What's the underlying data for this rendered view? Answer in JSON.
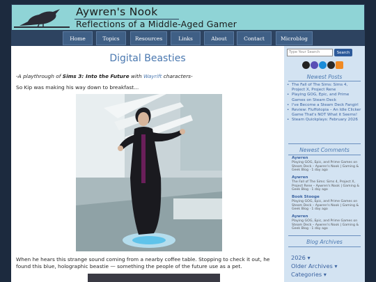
{
  "header": {
    "site_title": "Aywren's Nook",
    "site_subtitle": "Reflections of a Middle-Aged Gamer"
  },
  "nav": [
    "Home",
    "Topics",
    "Resources",
    "Links",
    "About",
    "Contact",
    "Microblog"
  ],
  "post": {
    "title": "Digital Beasties",
    "intro_prefix": "-A playthrough of ",
    "intro_game": "Sims 3: Into the Future",
    "intro_with": " with ",
    "intro_link": "Wayrift",
    "intro_suffix": " characters-",
    "para1": "So Kip was making his way down to breakfast...",
    "para2": "When he hears this strange sound coming from a nearby coffee table. Stopping to check it out, he found this blue, holographic beastie — something the people of the future use as a pet."
  },
  "sidebar": {
    "search_placeholder": "Type Your Search",
    "search_button": "Search",
    "newest_posts_heading": "Newest Posts",
    "newest_posts": [
      "The Fall of The Sims: Sims 4, Project X, Project Rene",
      "Playing GOG, Epic, and Prime Games on Steam Deck",
      "I've Become a Steam Deck Fangirl",
      "Review: Fluffotopia – An Idle Clicker Game That's NOT What it Seems!",
      "Steam Quickplays: February 2026"
    ],
    "newest_comments_heading": "Newest Comments",
    "comments": [
      {
        "author": "Aywren",
        "text": "Playing GOG, Epic, and Prime Games on Steam Deck – Aywren's Nook | Gaming & Geek Blog · 1 day ago"
      },
      {
        "author": "Aywren",
        "text": "The Fall of The Sims: Sims 4, Project X, Project Rene – Aywren's Nook | Gaming & Geek Blog · 1 day ago"
      },
      {
        "author": "Book Stooge",
        "text": "Playing GOG, Epic, and Prime Games on Steam Deck – Aywren's Nook | Gaming & Geek Blog · 1 day ago"
      },
      {
        "author": "Aywren",
        "text": "Playing GOG, Epic, and Prime Games on Steam Deck – Aywren's Nook | Gaming & Geek Blog · 1 day ago"
      }
    ],
    "archives_heading": "Blog Archives",
    "archive_items": [
      "2026 ▾",
      "Older Archives ▾",
      "Categories ▾"
    ]
  }
}
